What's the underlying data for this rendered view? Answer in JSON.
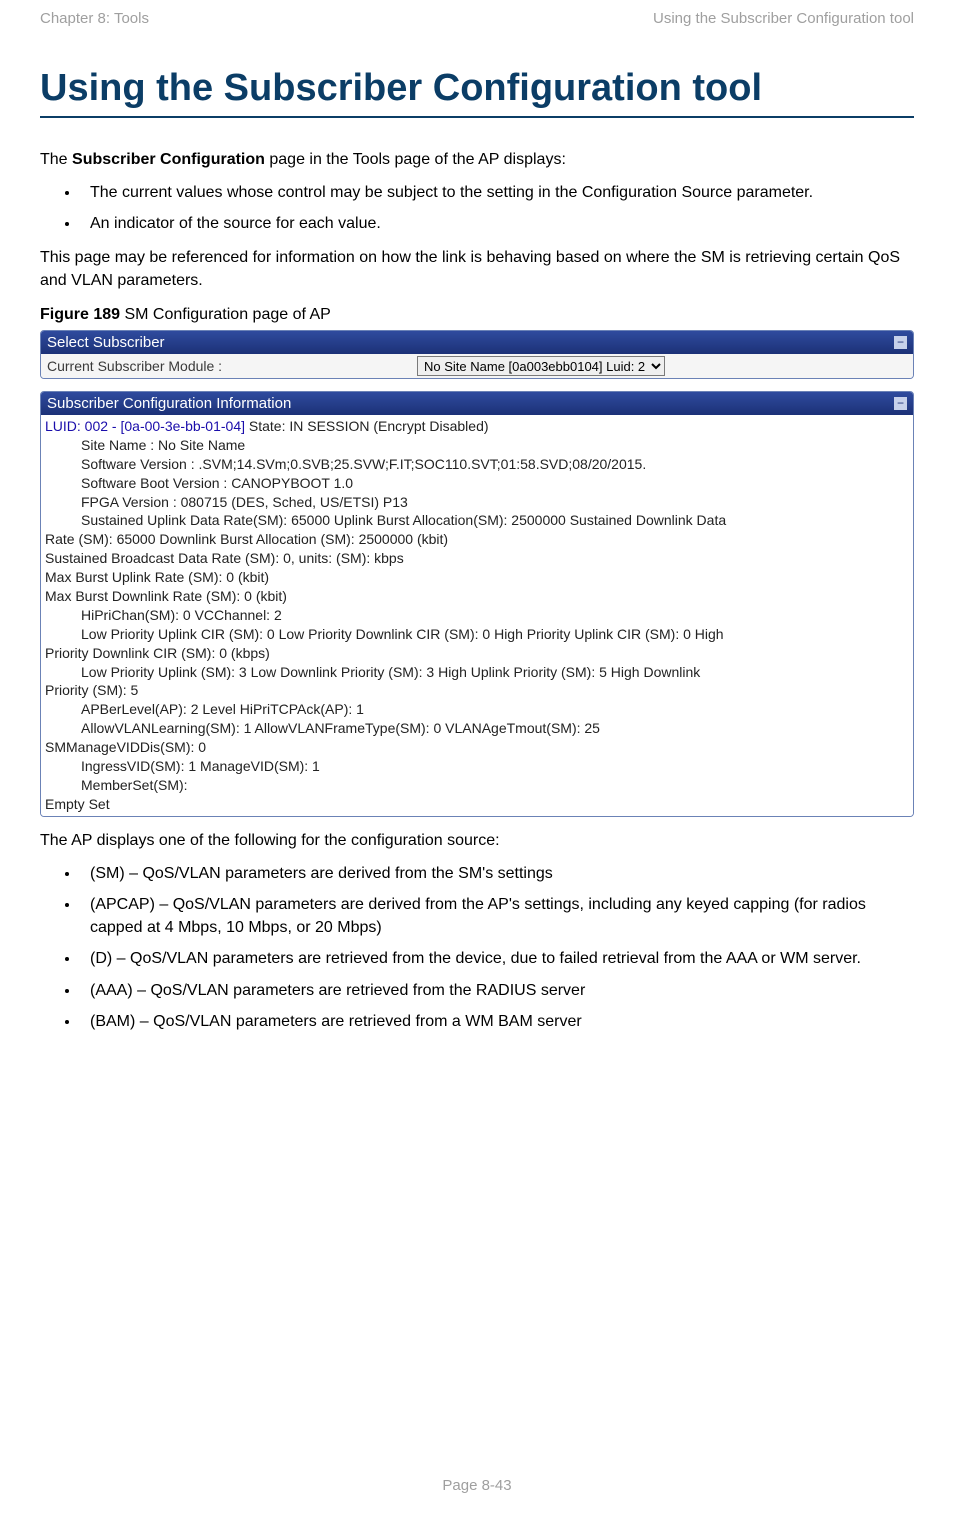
{
  "running_header": {
    "left": "Chapter 8:  Tools",
    "right": "Using the Subscriber Configuration tool"
  },
  "title": "Using the Subscriber Configuration tool",
  "intro": {
    "p1_prefix": "The ",
    "p1_bold": "Subscriber Configuration",
    "p1_suffix": " page in the Tools page of the AP displays:",
    "bullets_top": [
      {
        "prefix": "The current values whose control may be subject to the setting in the ",
        "bold": "Configuration Source",
        "suffix": " parameter."
      },
      {
        "text": "An indicator of the source for each value."
      }
    ],
    "p2": "This page may be referenced for information on how the link is behaving based on where the SM is retrieving certain QoS and VLAN parameters."
  },
  "figure": {
    "label_bold": "Figure 189",
    "label_rest": " SM Configuration page of AP"
  },
  "select_panel": {
    "title": "Select Subscriber",
    "label": "Current Subscriber Module :",
    "selected": "No Site Name [0a003ebb0104] Luid: 2"
  },
  "config_panel": {
    "title": "Subscriber Configuration Information",
    "luid": "LUID: 002 - [0a-00-3e-bb-01-04]",
    "state": " State: IN SESSION (Encrypt Disabled)",
    "lines": {
      "site": "Site Name : No Site Name",
      "sw_ver": "Software Version : .SVM;14.SVm;0.SVB;25.SVW;F.IT;SOC110.SVT;01:58.SVD;08/20/2015.",
      "boot_ver": "Software Boot Version : CANOPYBOOT 1.0",
      "fpga": "FPGA Version : 080715 (DES, Sched, US/ETSI) P13",
      "sust_ul": "Sustained Uplink Data Rate(SM): 65000 Uplink Burst Allocation(SM): 2500000 Sustained Downlink Data",
      "rate_sm": "Rate (SM): 65000 Downlink Burst Allocation (SM): 2500000 (kbit)",
      "sust_bcast": "Sustained Broadcast Data Rate (SM): 0, units: (SM): kbps",
      "max_ul": "Max Burst Uplink Rate (SM): 0 (kbit)",
      "max_dl": "Max Burst Downlink Rate (SM): 0 (kbit)",
      "hipri": "HiPriChan(SM): 0 VCChannel: 2",
      "low_pri_ul": "Low Priority Uplink CIR (SM): 0 Low Priority Downlink CIR (SM): 0 High Priority Uplink CIR (SM): 0 High",
      "pri_dl": "Priority Downlink CIR (SM): 0 (kbps)",
      "low_pri_ul2": "Low Priority Uplink (SM): 3 Low Downlink Priority (SM): 3 High Uplink Priority (SM): 5 High Downlink",
      "pri_sm": "Priority (SM): 5",
      "apber": "APBerLevel(AP): 2 Level HiPriTCPAck(AP): 1",
      "allow_vlan": "AllowVLANLearning(SM): 1 AllowVLANFrameType(SM): 0 VLANAgeTmout(SM): 25",
      "smmanage": "SMManageVIDDis(SM): 0",
      "ingress": "IngressVID(SM): 1 ManageVID(SM): 1",
      "member": "MemberSet(SM):",
      "empty": "Empty Set"
    }
  },
  "after_figure": {
    "p": "The AP displays one of the following for the configuration source:",
    "bullets": [
      "(SM) – QoS/VLAN parameters are derived from the SM's settings",
      "(APCAP) – QoS/VLAN parameters are derived from the AP's settings, including any keyed capping (for radios capped at 4 Mbps, 10 Mbps, or 20 Mbps)",
      "(D) – QoS/VLAN parameters are retrieved from the device, due to failed retrieval from the AAA or WM server.",
      "(AAA) – QoS/VLAN parameters are retrieved from the RADIUS server",
      "(BAM) – QoS/VLAN parameters are retrieved from a WM BAM server"
    ]
  },
  "page_number": "Page 8-43"
}
